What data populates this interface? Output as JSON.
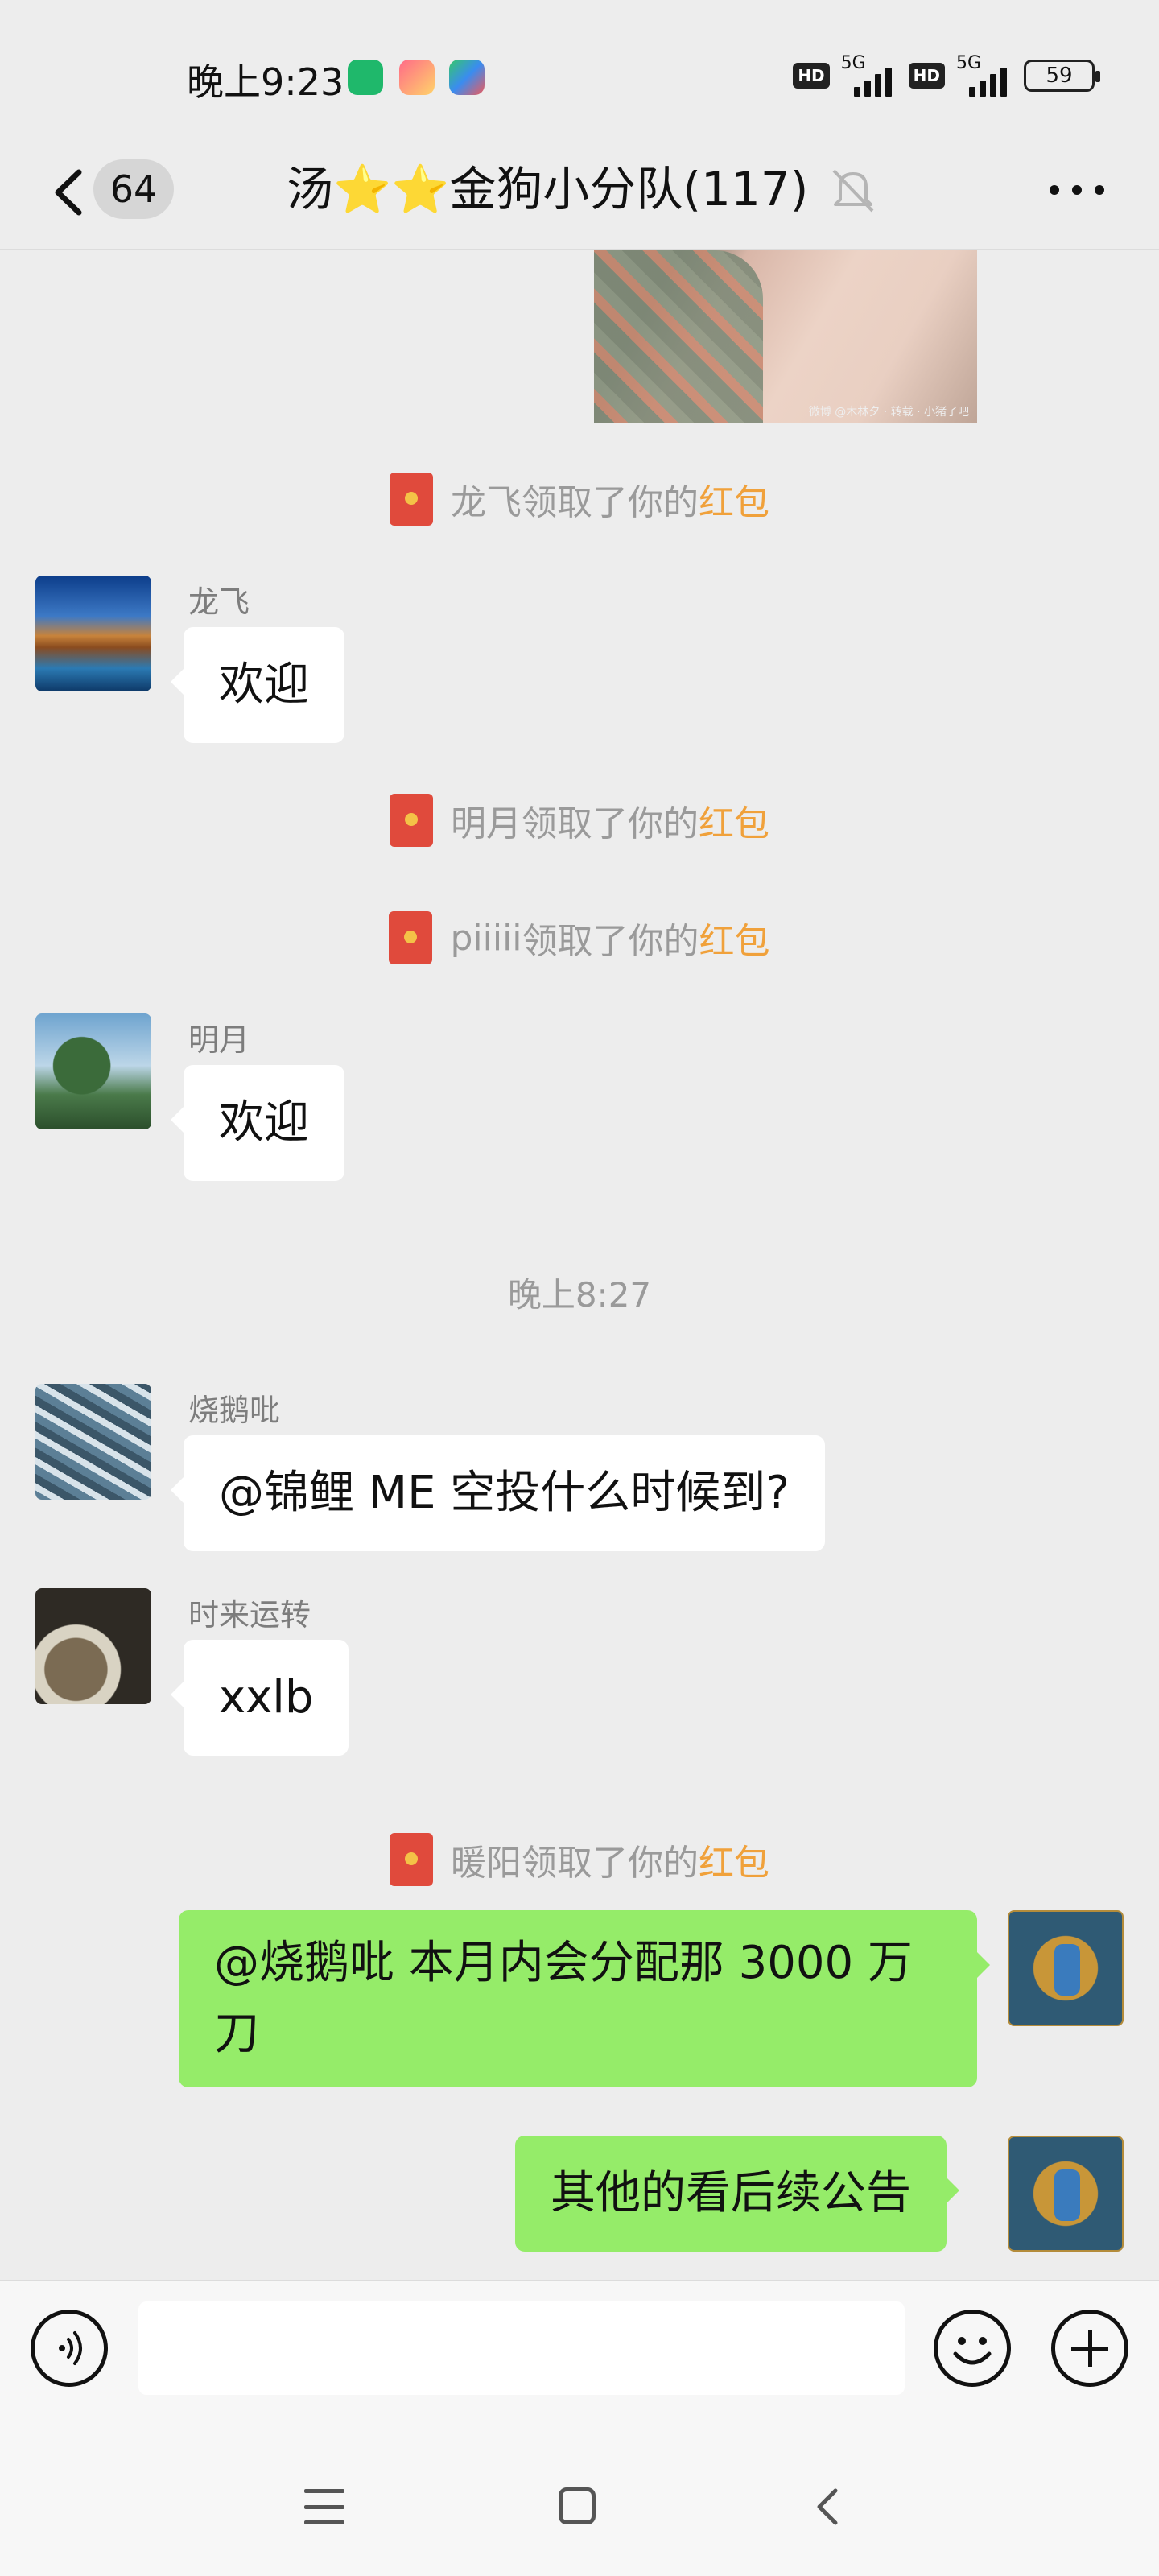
{
  "status_bar": {
    "time": "晚上9:23",
    "hd_badge": "HD",
    "network_label": "5G",
    "battery_level": "59"
  },
  "header": {
    "unread_count": "64",
    "title": "汤⭐⭐金狗小分队(117)"
  },
  "chat": {
    "photo_watermark": "微博 @木林夕 · 转载 · 小猪了吧",
    "system_messages": [
      {
        "name": "龙飞",
        "text": "领取了你的",
        "highlight": "红包"
      },
      {
        "name": "明月",
        "text": "领取了你的",
        "highlight": "红包"
      },
      {
        "name": "piiiii",
        "text": "领取了你的",
        "highlight": "红包"
      },
      {
        "name": "暖阳",
        "text": "领取了你的",
        "highlight": "红包"
      }
    ],
    "timestamp": "晚上8:27",
    "messages": [
      {
        "sender": "龙飞",
        "text": "欢迎"
      },
      {
        "sender": "明月",
        "text": "欢迎"
      },
      {
        "sender": "烧鹅吡",
        "text": "@锦鲤 ME 空投什么时候到?"
      },
      {
        "sender": "时来运转",
        "text": "xxlb"
      },
      {
        "sender": "",
        "text": "@烧鹅吡  本月内会分配那 3000 万刀"
      },
      {
        "sender": "",
        "text": "其他的看后续公告"
      }
    ]
  },
  "input": {
    "placeholder": ""
  },
  "colors": {
    "background": "#ededed",
    "self_bubble": "#95ec69",
    "other_bubble": "#ffffff",
    "red_packet_highlight": "#f0a13b"
  },
  "icons": [
    "back-arrow-icon",
    "mute-bell-icon",
    "more-icon",
    "red-packet-icon",
    "voice-icon",
    "emoji-icon",
    "plus-icon",
    "nav-menu-icon",
    "nav-home-icon",
    "nav-back-icon"
  ]
}
